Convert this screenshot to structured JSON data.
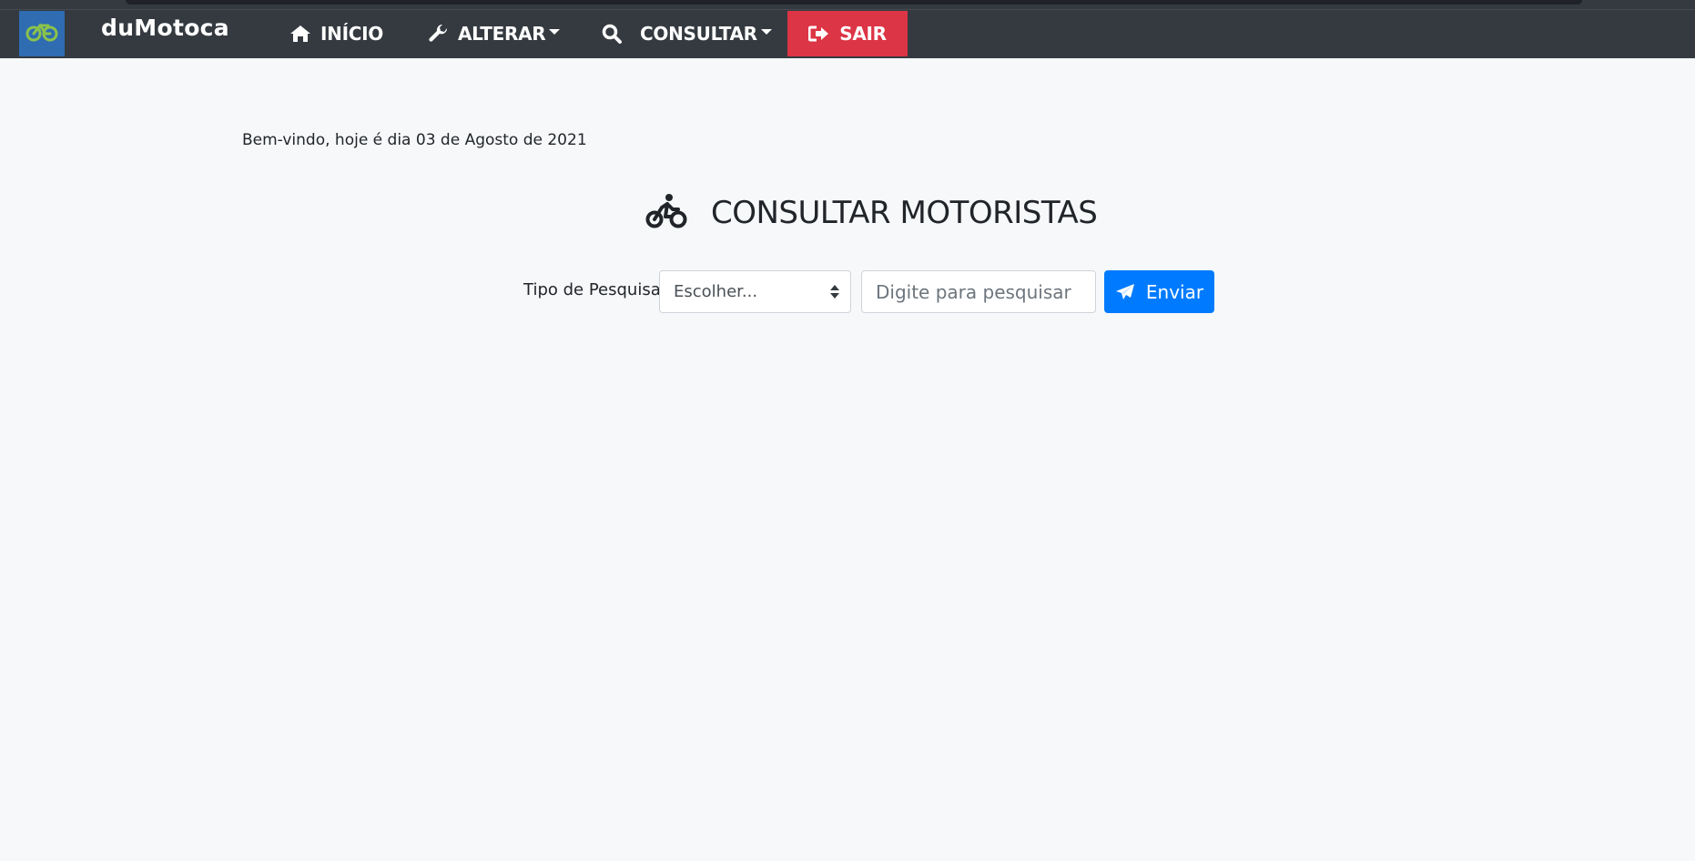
{
  "navbar": {
    "brand": "duMotoca",
    "logo_icon": "bicycle-icon",
    "items": [
      {
        "label": "INÍCIO",
        "icon": "home-icon"
      },
      {
        "label": "ALTERAR",
        "icon": "wrench-icon",
        "dropdown": true
      },
      {
        "label": "CONSULTAR",
        "icon": "search-icon",
        "dropdown": true
      },
      {
        "label": "SAIR",
        "icon": "sign-out-icon"
      }
    ],
    "colors": {
      "background": "#343a40",
      "sair": "#dc3545",
      "logo_bg": "#2f6cb2",
      "logo_icon": "#8bc34a"
    }
  },
  "main": {
    "welcome": "Bem-vindo, hoje é dia 03 de Agosto de 2021",
    "heading": "CONSULTAR MOTORISTAS",
    "heading_icon": "motorcycle-rider-icon"
  },
  "search": {
    "label": "Tipo de Pesquisa",
    "select_value": "Escolher...",
    "input_value": "",
    "input_placeholder": "Digite para pesquisar",
    "button_label": "Enviar",
    "button_icon": "paper-plane-icon",
    "button_color": "#007bff"
  }
}
